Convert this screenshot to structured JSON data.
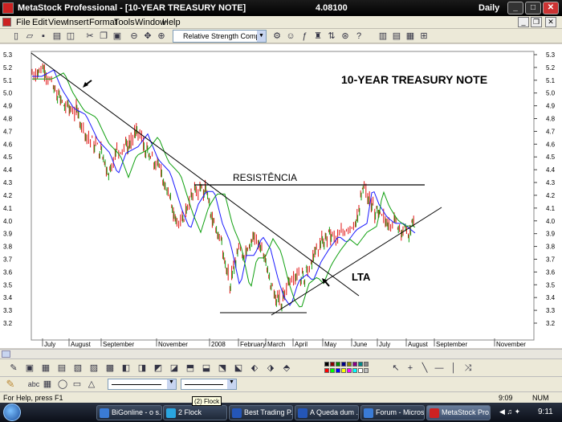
{
  "window": {
    "title": "MetaStock Professional - [10-YEAR TREASURY NOTE]",
    "last_price": "4.08100",
    "periodicity": "Daily",
    "minimize": "_",
    "maximize": "□",
    "close": "✕"
  },
  "menu": [
    "File",
    "Edit",
    "View",
    "Insert",
    "Format",
    "Tools",
    "Window",
    "Help"
  ],
  "mdi_controls": [
    "_",
    "❐",
    "✕"
  ],
  "toolbar": {
    "indicator_select": "Relative Strength Comparati",
    "icons": [
      "new-icon",
      "open-icon",
      "save-icon",
      "print-icon",
      "print-preview-icon",
      "cut-icon",
      "copy-icon",
      "paste-icon",
      "zoom-out-icon",
      "move-icon",
      "zoom-in-icon",
      "indicator-icon",
      "expert-icon",
      "formula-icon",
      "system-tester-icon",
      "explorer-icon",
      "whats-this-icon",
      "window-icons"
    ]
  },
  "chart": {
    "title": "10-YEAR TREASURY NOTE",
    "annotation_resistance": "RESISTÊNCIA",
    "annotation_lta": "LTA",
    "y_ticks": [
      "5.3",
      "5.2",
      "5.1",
      "5.0",
      "4.9",
      "4.8",
      "4.7",
      "4.6",
      "4.5",
      "4.4",
      "4.3",
      "4.2",
      "4.1",
      "4.0",
      "3.9",
      "3.8",
      "3.7",
      "3.6",
      "3.5",
      "3.4",
      "3.3",
      "3.2"
    ],
    "x_ticks": [
      "July",
      "August",
      "September",
      "November",
      "2008",
      "February",
      "March",
      "April",
      "May",
      "June",
      "July",
      "August",
      "September",
      "November"
    ],
    "colors": {
      "price": "#e01010",
      "ma_short": "#1a1aff",
      "ma_long": "#10a010",
      "line": "#000000"
    }
  },
  "status": {
    "help_text": "For Help, press F1",
    "time": "9:09",
    "num": "NUM"
  },
  "taskbar": {
    "tasks": [
      "BiGonline - o s...",
      "2 Flock",
      "Best Trading P...",
      "A Queda dum ...",
      "Forum - Micros...",
      "MetaStock Pro..."
    ],
    "tooltip": "(2) Flock",
    "clock": "9:11"
  }
}
